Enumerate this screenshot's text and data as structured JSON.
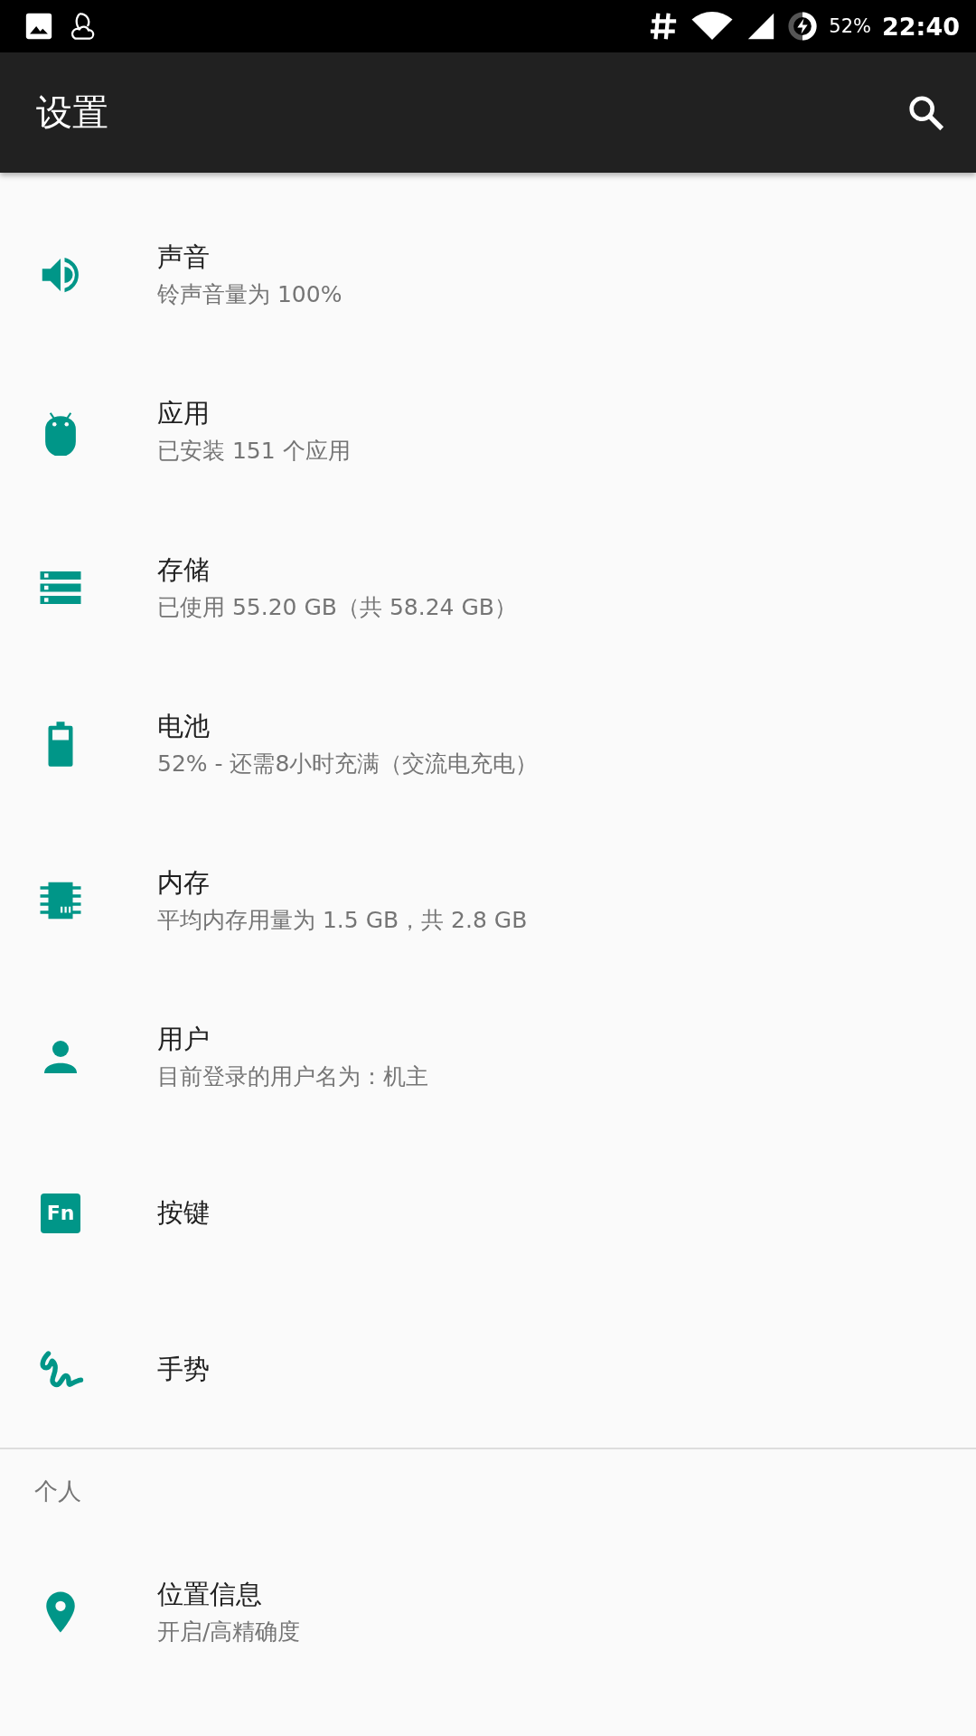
{
  "status_bar": {
    "battery": "52%",
    "time": "22:40"
  },
  "toolbar": {
    "title": "设置"
  },
  "items": [
    {
      "kind": "sound",
      "title": "声音",
      "subtitle": "铃声音量为 100%"
    },
    {
      "kind": "apps",
      "title": "应用",
      "subtitle": "已安装 151 个应用"
    },
    {
      "kind": "storage",
      "title": "存储",
      "subtitle": "已使用 55.20 GB（共 58.24 GB）"
    },
    {
      "kind": "battery",
      "title": "电池",
      "subtitle": "52% - 还需8小时充满（交流电充电）"
    },
    {
      "kind": "memory",
      "title": "内存",
      "subtitle": "平均内存用量为 1.5 GB，共 2.8 GB"
    },
    {
      "kind": "user",
      "title": "用户",
      "subtitle": "目前登录的用户名为：机主"
    },
    {
      "kind": "fn",
      "title": "按键",
      "icon_text": "Fn"
    },
    {
      "kind": "gesture",
      "title": "手势"
    }
  ],
  "section": {
    "header": "个人",
    "items": [
      {
        "kind": "location",
        "title": "位置信息",
        "subtitle": "开启/高精确度"
      }
    ]
  }
}
